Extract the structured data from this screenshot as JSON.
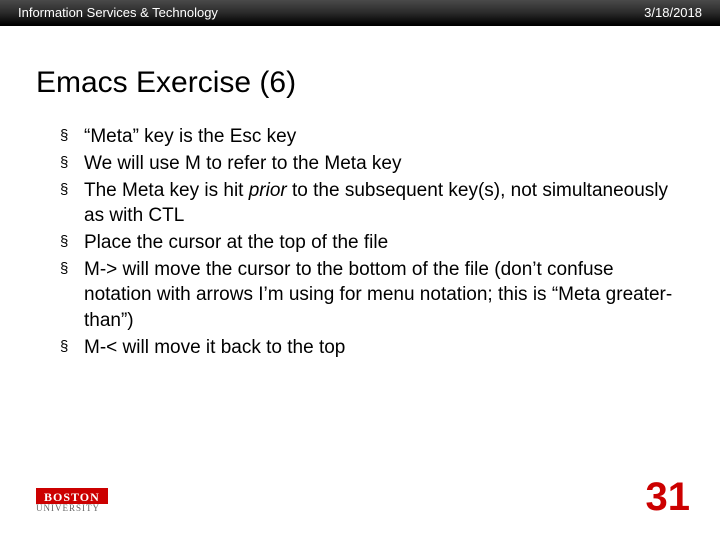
{
  "header": {
    "left": "Information Services & Technology",
    "right": "3/18/2018"
  },
  "title": "Emacs Exercise (6)",
  "bullets": [
    {
      "pre": "“Meta” key is the Esc key",
      "italic": "",
      "post": ""
    },
    {
      "pre": "We will use M to refer to the Meta key",
      "italic": "",
      "post": ""
    },
    {
      "pre": "The Meta key is hit ",
      "italic": "prior",
      "post": " to the subsequent key(s), not simultaneously as with CTL"
    },
    {
      "pre": "Place the cursor at the top of the file",
      "italic": "",
      "post": ""
    },
    {
      "pre": "M-> will move the cursor to the bottom of the file (don’t confuse notation with arrows I’m using for menu notation; this is “Meta greater-than”)",
      "italic": "",
      "post": ""
    },
    {
      "pre": "M-< will move it back to the top",
      "italic": "",
      "post": ""
    }
  ],
  "logo": {
    "line1": "BOSTON",
    "line2": "UNIVERSITY"
  },
  "page_number": "31",
  "bullet_marker": "§"
}
